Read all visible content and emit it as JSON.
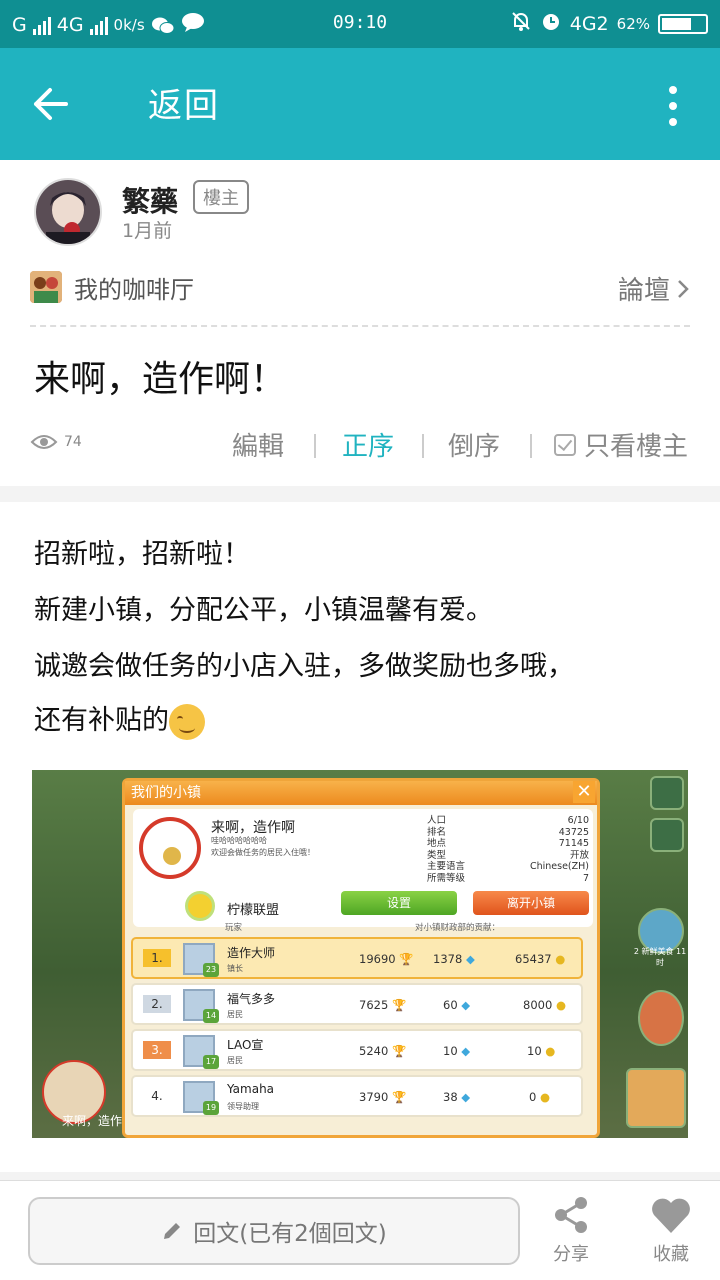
{
  "status_bar": {
    "carrier_left": "G",
    "network": "4G",
    "speed": "0k/s",
    "time": "09:10",
    "network_right": "4G2",
    "battery": "62%",
    "battery_level": 0.62
  },
  "app_bar": {
    "title": "返回"
  },
  "post": {
    "author": "繁藥",
    "owner_badge": "樓主",
    "time": "1月前",
    "forum_name": "我的咖啡厅",
    "forum_link": "論壇",
    "title": "来啊，造作啊！",
    "views": "74",
    "toolbar": {
      "edit": "編輯",
      "order_asc": "正序",
      "order_desc": "倒序",
      "only_owner": "只看樓主"
    },
    "body_lines": [
      "招新啦，招新啦！",
      "新建小镇，分配公平，小镇温馨有爱。",
      "诚邀会做任务的小店入驻，多做奖励也多哦，",
      "还有补贴的"
    ]
  },
  "game": {
    "panel_title": "我们的小镇",
    "town_name": "来啊，造作啊",
    "town_sub1": "哇哈哈哈哈哈哈",
    "town_sub2": "欢迎会做任务的居民入住哦！",
    "info_labels": [
      "人口",
      "排名",
      "地点",
      "类型",
      "主要语言",
      "所需等级"
    ],
    "info_values": [
      "6/10",
      "43725",
      "71145",
      "开放",
      "Chinese(ZH)",
      "7"
    ],
    "alliance": "柠檬联盟",
    "btn_settings": "设置",
    "btn_leave": "离开小镇",
    "col_player": "玩家",
    "col_contrib": "对小镇财政部的贡献：",
    "rows": [
      {
        "rank": "1.",
        "level": "23",
        "name": "造作大师",
        "role": "镇长",
        "a": "19690",
        "b": "1378",
        "c": "65437"
      },
      {
        "rank": "2.",
        "level": "14",
        "name": "福气多多",
        "role": "居民",
        "a": "7625",
        "b": "60",
        "c": "8000"
      },
      {
        "rank": "3.",
        "level": "17",
        "name": "LAO宣",
        "role": "居民",
        "a": "5240",
        "b": "10",
        "c": "10"
      },
      {
        "rank": "4.",
        "level": "19",
        "name": "Yamaha",
        "role": "领导助理",
        "a": "3790",
        "b": "38",
        "c": "0"
      }
    ],
    "side_label": "2 新鲜美食 11时",
    "bottom_label": "来啊，造作"
  },
  "bottom_bar": {
    "reply_placeholder": "回文(已有2個回文)",
    "share": "分享",
    "favorite": "收藏"
  }
}
